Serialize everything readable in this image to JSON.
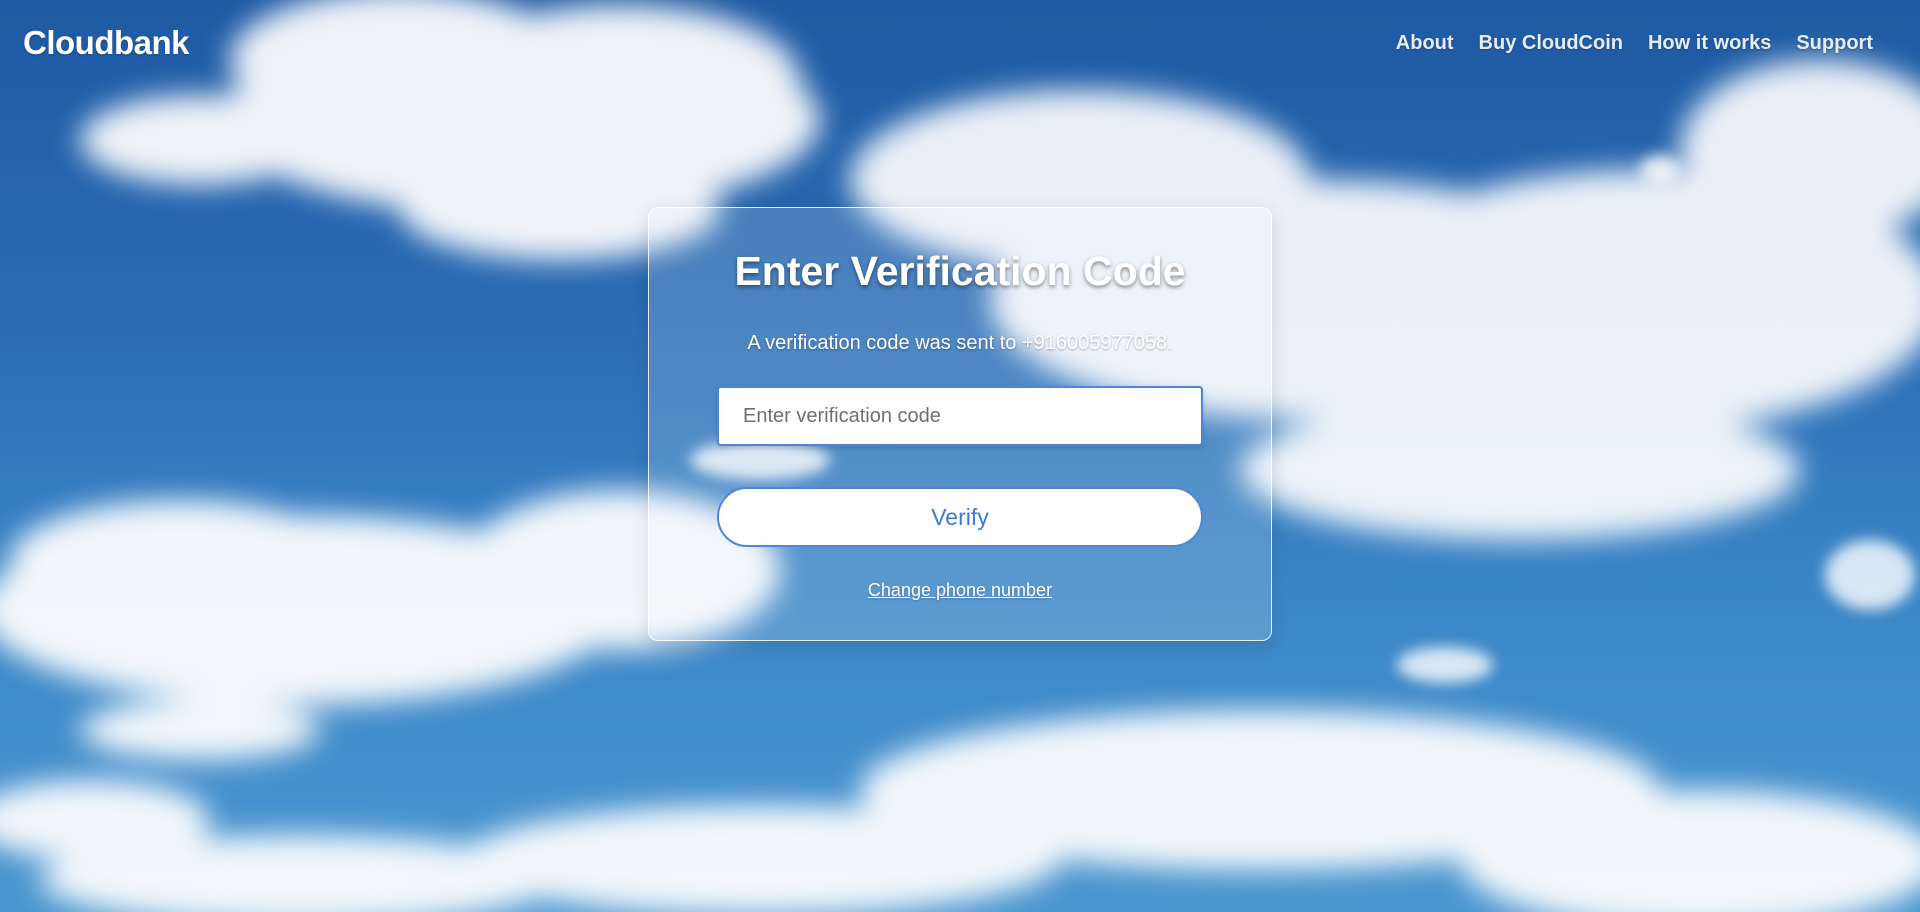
{
  "header": {
    "logo": "Cloudbank",
    "nav": [
      {
        "label": "About"
      },
      {
        "label": "Buy CloudCoin"
      },
      {
        "label": "How it works"
      },
      {
        "label": "Support"
      }
    ]
  },
  "verification": {
    "title": "Enter Verification Code",
    "message": "A verification code was sent to +916005977058.",
    "input_placeholder": "Enter verification code",
    "input_value": "",
    "verify_label": "Verify",
    "change_phone_label": "Change phone number"
  },
  "colors": {
    "accent": "#4f86d6",
    "button_text": "#3c7ad0",
    "sky_top": "#1f5aa3",
    "sky_bottom": "#4c97d0"
  }
}
